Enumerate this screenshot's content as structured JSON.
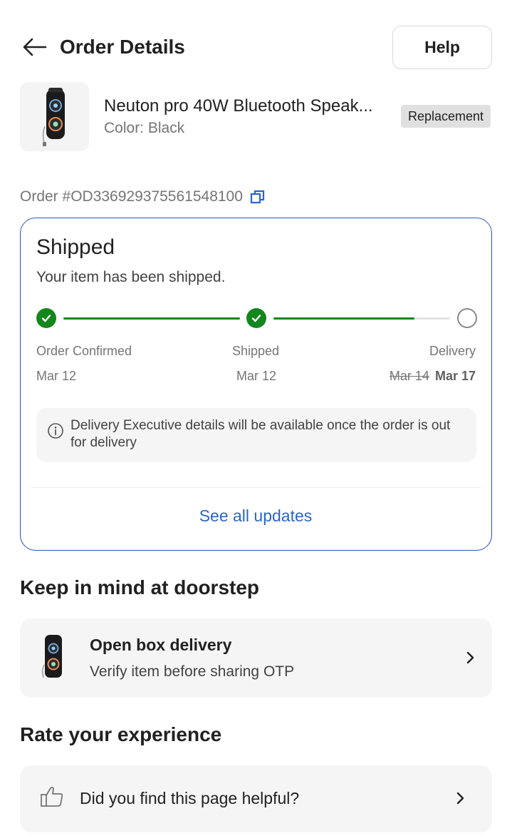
{
  "header": {
    "title": "Order Details",
    "help_label": "Help"
  },
  "product": {
    "name": "Neuton pro 40W Bluetooth Speak...",
    "color": "Color: Black",
    "badge": "Replacement"
  },
  "order": {
    "id_text": "Order #OD336929375561548100"
  },
  "status": {
    "title": "Shipped",
    "subtitle": "Your item has been shipped.",
    "steps": [
      {
        "label": "Order Confirmed",
        "date": "Mar 12",
        "state": "done"
      },
      {
        "label": "Shipped",
        "date": "Mar 12",
        "state": "done"
      },
      {
        "label": "Delivery",
        "date_old": "Mar 14",
        "date": "Mar 17",
        "state": "pending"
      }
    ],
    "progress_to_delivery": 0.8,
    "info": "Delivery Executive details will be available once the order is out for delivery",
    "see_updates_label": "See all updates"
  },
  "doorstep": {
    "section_title": "Keep in mind at doorstep",
    "title": "Open box delivery",
    "subtitle": "Verify item before sharing OTP"
  },
  "rating": {
    "section_title": "Rate your experience",
    "question": "Did you find this page helpful?"
  },
  "colors": {
    "accent_blue": "#2a66c8",
    "card_border": "#2a55b8",
    "success_green": "#13871d"
  },
  "icons": {
    "back": "arrow-left-icon",
    "copy": "copy-icon",
    "check": "check-icon",
    "info": "info-icon",
    "chevron": "chevron-right-icon",
    "thumbs_up": "thumbs-up-icon"
  }
}
